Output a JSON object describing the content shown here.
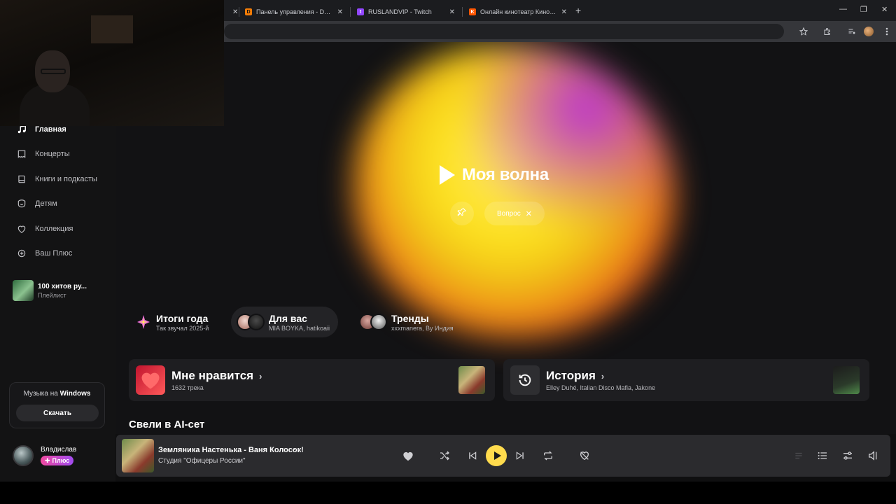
{
  "browser": {
    "tabs": [
      {
        "title": "Панель управления - Donation",
        "favicon": "donationalerts-icon",
        "close": "✕"
      },
      {
        "title": "RUSLANDVIP - Twitch",
        "favicon": "twitch-icon",
        "close": "✕"
      },
      {
        "title": "Онлайн кинотеатр Кинопоиск",
        "favicon": "kinopoisk-icon",
        "close": "✕"
      }
    ],
    "first_tab_close": "✕",
    "new_tab": "+",
    "window_controls": [
      "—",
      "❐",
      "✕"
    ]
  },
  "sidebar": {
    "nav": [
      {
        "label": "Главная",
        "icon": "music-note-icon",
        "active": true
      },
      {
        "label": "Концерты",
        "icon": "ticket-icon"
      },
      {
        "label": "Книги и подкасты",
        "icon": "book-icon"
      },
      {
        "label": "Детям",
        "icon": "kids-icon"
      },
      {
        "label": "Коллекция",
        "icon": "heart-icon"
      },
      {
        "label": "Ваш Плюс",
        "icon": "plus-icon"
      }
    ],
    "playlist": {
      "title": "100 хитов ру...",
      "subtitle": "Плейлист"
    },
    "promo": {
      "text_prefix": "Музыка на ",
      "text_bold": "Windows",
      "button": "Скачать"
    },
    "user": {
      "name": "Владислав",
      "badge": "Плюс"
    }
  },
  "wave": {
    "title": "Моя волна",
    "chip": "Вопрос",
    "chip_close": "✕"
  },
  "shortcuts": [
    {
      "title": "Итоги года",
      "subtitle": "Так звучал 2025-й"
    },
    {
      "title": "Для вас",
      "subtitle": "MIA BOYKA, hatikoaii"
    },
    {
      "title": "Тренды",
      "subtitle": "xxxmanera, By Индия"
    }
  ],
  "cards": [
    {
      "title": "Мне нравится",
      "subtitle": "1632 трека",
      "chevron": "›"
    },
    {
      "title": "История",
      "subtitle": "Elley Duhé, Italian Disco Mafia, Jakone",
      "chevron": "›"
    }
  ],
  "section_title": "Свели в AI-сет",
  "player": {
    "track_title": "Земляника Настенька - Ваня Колосок!",
    "more": "···",
    "artist": "Студия \"Офицеры России\""
  },
  "colors": {
    "accent_yellow": "#ffdb4d",
    "plus_gradient_start": "#f04aa0",
    "plus_gradient_end": "#a14bf1",
    "background": "#121214"
  }
}
